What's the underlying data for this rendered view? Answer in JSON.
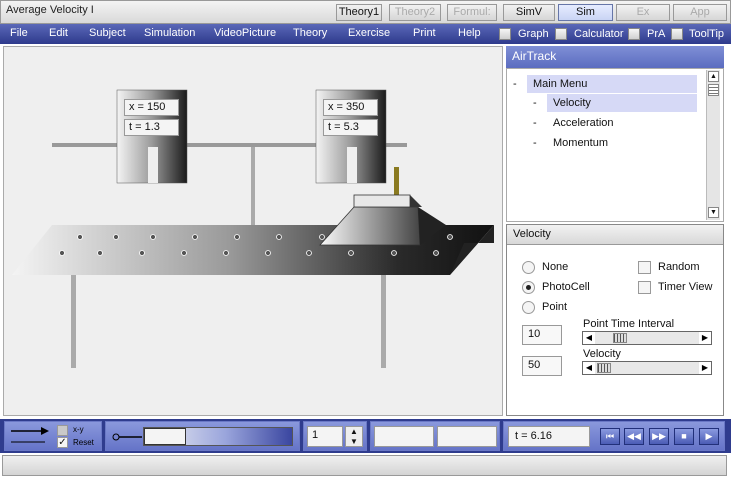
{
  "window": {
    "title": "Average Velocity I",
    "tabs": [
      {
        "label": "Theory1",
        "state": "normal"
      },
      {
        "label": "Theory2",
        "state": "disabled"
      },
      {
        "label": "Formul:",
        "state": "disabled"
      },
      {
        "label": "SimV",
        "state": "normal"
      },
      {
        "label": "Sim",
        "state": "active"
      },
      {
        "label": "Ex",
        "state": "disabled"
      },
      {
        "label": "App",
        "state": "disabled"
      }
    ]
  },
  "menubar": {
    "items": [
      "File",
      "Edit",
      "Subject",
      "Simulation",
      "VideoPicture",
      "Theory",
      "Exercise",
      "Print",
      "Help"
    ],
    "toggles": [
      "Graph",
      "Calculator",
      "PrA",
      "ToolTip"
    ]
  },
  "simulation": {
    "photocell_1": {
      "x_text": "x = 150",
      "t_text": "t = 1.3"
    },
    "photocell_2": {
      "x_text": "x = 350",
      "t_text": "t = 5.3"
    }
  },
  "sidepanel": {
    "header": "AirTrack",
    "tree": [
      {
        "prefix": "-",
        "label": "Main Menu",
        "level": 0,
        "highlighted": true
      },
      {
        "prefix": "-",
        "label": "Velocity",
        "level": 1,
        "highlighted": true
      },
      {
        "prefix": "-",
        "label": "Acceleration",
        "level": 1,
        "highlighted": false
      },
      {
        "prefix": "-",
        "label": "Momentum",
        "level": 1,
        "highlighted": false
      }
    ]
  },
  "velocity_panel": {
    "title": "Velocity",
    "radios": [
      {
        "label": "None",
        "checked": false
      },
      {
        "label": "PhotoCell",
        "checked": true
      },
      {
        "label": "Point",
        "checked": false
      }
    ],
    "checkboxes": [
      {
        "label": "Random",
        "checked": false
      },
      {
        "label": "Timer View",
        "checked": false
      }
    ],
    "point_interval": {
      "value": "10",
      "label": "Point Time Interval"
    },
    "velocity": {
      "value": "50",
      "label": "Velocity"
    }
  },
  "bottombar": {
    "xy_label": "x-y",
    "reset_label": "Reset",
    "reset_checked": true,
    "spinner_value": "1",
    "time_text": "t = 6.16",
    "controls": [
      "rewind-start",
      "step-back",
      "fast-forward",
      "stop",
      "play"
    ]
  },
  "colors": {
    "menubar": "#3a46a0",
    "accent": "#5b6cc0",
    "highlight": "#d6d9f6"
  }
}
